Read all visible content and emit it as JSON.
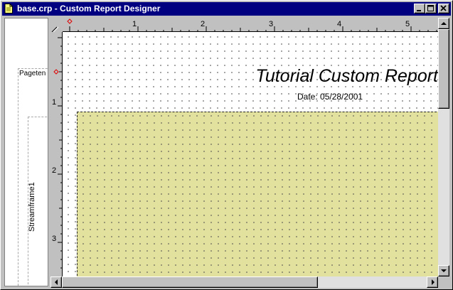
{
  "window": {
    "title": "base.crp - Custom Report Designer",
    "icon": "document-icon",
    "controls": [
      "minimize-icon",
      "maximize-icon",
      "close-icon"
    ]
  },
  "left_pane": {
    "frames": [
      {
        "label": "Pageten"
      },
      {
        "label": "Streamframe1"
      }
    ]
  },
  "rulers": {
    "horizontal_labels": [
      "1",
      "2",
      "3",
      "4",
      "5"
    ],
    "vertical_labels": [
      "1",
      "2",
      "3"
    ]
  },
  "report": {
    "title": "Tutorial Custom Report",
    "date_line": "Date: 05/28/2001"
  },
  "colors": {
    "title_bar": "#000080",
    "stream_frame_fill": "#e2e29e",
    "canvas": "#ffffff"
  }
}
